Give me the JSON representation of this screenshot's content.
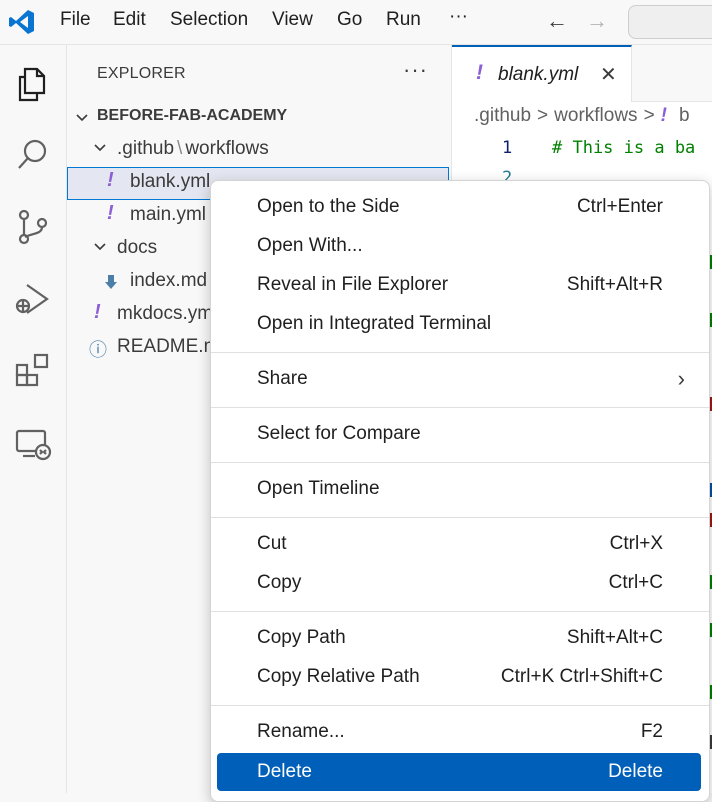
{
  "titlebar": {
    "menu": [
      "File",
      "Edit",
      "Selection",
      "View",
      "Go",
      "Run",
      "···"
    ],
    "back_arrow": "←",
    "forward_arrow": "→"
  },
  "activity_icons": [
    "explorer-icon",
    "search-icon",
    "source-control-icon",
    "run-debug-icon",
    "extensions-icon",
    "remote-explorer-icon"
  ],
  "sidebar": {
    "title": "EXPLORER",
    "more": "···",
    "tree": {
      "root": "BEFORE-FAB-ACADEMY",
      "folder1_part1": ".github",
      "folder1_sep": "\\",
      "folder1_part2": "workflows",
      "file1": "blank.yml",
      "file2": "main.yml",
      "folder2": "docs",
      "file3": "index.md",
      "file4": "mkdocs.yml",
      "file5": "README.md",
      "yaml_icon": "!",
      "info_icon": "ⓘ"
    }
  },
  "editor": {
    "tab_icon": "!",
    "tab_label": "blank.yml",
    "tab_close": "✕",
    "breadcrumbs": [
      ".github",
      "workflows"
    ],
    "breadcrumb_sep": ">",
    "breadcrumb_icon": "!",
    "breadcrumb_tail": "b",
    "line1_num": "1",
    "line2_num": "2",
    "line1_code": "# This is a ba"
  },
  "context_menu": {
    "open_side": {
      "label": "Open to the Side",
      "key": "Ctrl+Enter"
    },
    "open_with": {
      "label": "Open With..."
    },
    "reveal": {
      "label": "Reveal in File Explorer",
      "key": "Shift+Alt+R"
    },
    "open_terminal": {
      "label": "Open in Integrated Terminal"
    },
    "share": {
      "label": "Share",
      "arrow": "›"
    },
    "select_compare": {
      "label": "Select for Compare"
    },
    "timeline": {
      "label": "Open Timeline"
    },
    "cut": {
      "label": "Cut",
      "key": "Ctrl+X"
    },
    "copy": {
      "label": "Copy",
      "key": "Ctrl+C"
    },
    "copy_path": {
      "label": "Copy Path",
      "key": "Shift+Alt+C"
    },
    "copy_rel_path": {
      "label": "Copy Relative Path",
      "key": "Ctrl+K Ctrl+Shift+C"
    },
    "rename": {
      "label": "Rename...",
      "key": "F2"
    },
    "delete": {
      "label": "Delete",
      "key": "Delete"
    }
  },
  "colors": {
    "accent": "#005fb8",
    "yaml_icon": "#8d5fd3",
    "selection": "#e4e6f1",
    "comment": "#008000"
  }
}
